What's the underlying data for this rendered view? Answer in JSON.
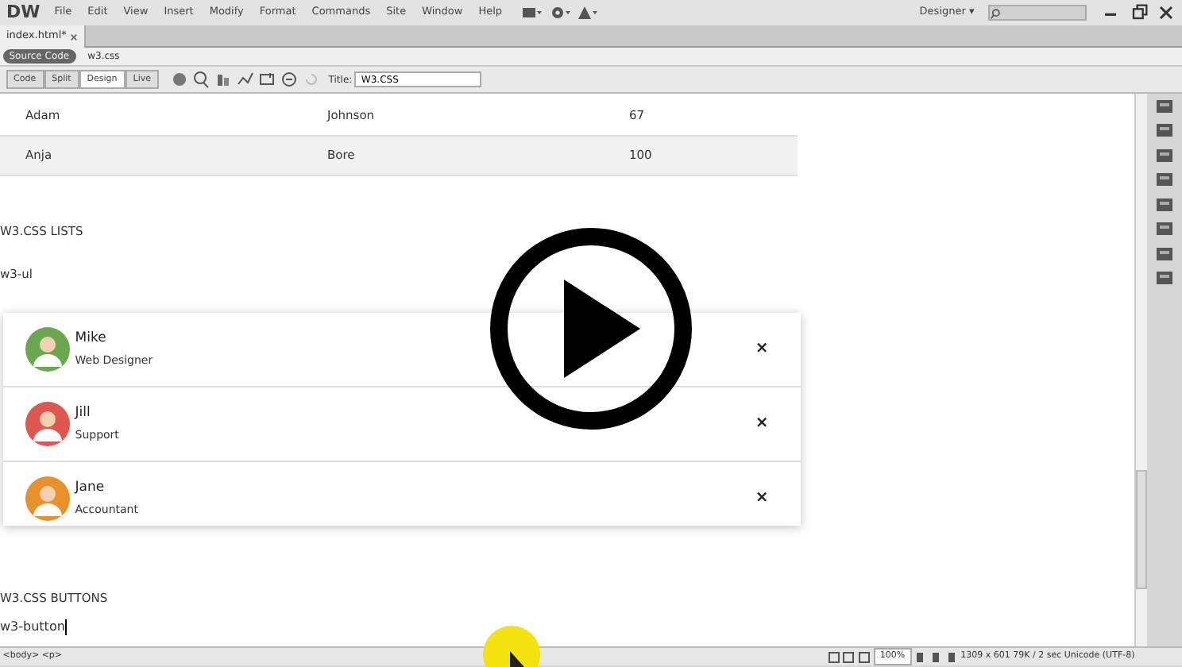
{
  "app": {
    "logo": "DW",
    "menus": [
      "File",
      "Edit",
      "View",
      "Insert",
      "Modify",
      "Format",
      "Commands",
      "Site",
      "Window",
      "Help"
    ],
    "workspace": "Designer",
    "workspace_caret": "▾"
  },
  "document_tabs": [
    {
      "label": "index.html*",
      "selected": true
    }
  ],
  "related_files": [
    {
      "label": "Source Code",
      "selected": true
    },
    {
      "label": "w3.css",
      "selected": false
    }
  ],
  "view_buttons": [
    {
      "label": "Code",
      "selected": false
    },
    {
      "label": "Split",
      "selected": false
    },
    {
      "label": "Design",
      "selected": true
    },
    {
      "label": "Live",
      "selected": false
    }
  ],
  "title_field": {
    "label": "Title:",
    "value": "W3.CSS"
  },
  "table": {
    "rows": [
      {
        "cells": [
          "Adam",
          "Johnson",
          "67"
        ],
        "striped": false
      },
      {
        "cells": [
          "Anja",
          "Bore",
          "100"
        ],
        "striped": true
      }
    ]
  },
  "sections": [
    {
      "heading": "W3.CSS LISTS",
      "class_name": "w3-ul"
    }
  ],
  "people": [
    {
      "name": "Mike",
      "role": "Web Designer",
      "color": "#6aa84f",
      "close": "×"
    },
    {
      "name": "Jill",
      "role": "Support",
      "color": "#e0574f",
      "close": "×"
    },
    {
      "name": "Jane",
      "role": "Accountant",
      "color": "#e8912b",
      "close": "×"
    }
  ],
  "buttons_section": {
    "heading": "W3.CSS BUTTONS",
    "typed": "w3-button"
  },
  "status_bar": {
    "tags": [
      "<body>",
      "<p>"
    ],
    "zoom": "100%",
    "dimensions": "1309 x 601",
    "size": "79K / 2 sec",
    "encoding": "Unicode (UTF-8)"
  }
}
